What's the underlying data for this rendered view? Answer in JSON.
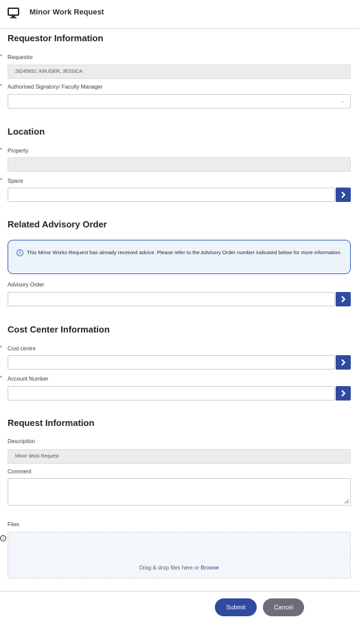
{
  "header": {
    "title": "Minor Work Request",
    "icon": "monitor-icon"
  },
  "sections": {
    "requestor": {
      "title": "Requestor Information",
      "requestor_label": "Requestor",
      "requestor_value": "28245652, KRUGER, JESSICA",
      "signatory_label": "Authorised Signatory/ Faculty Manager",
      "signatory_value": ""
    },
    "location": {
      "title": "Location",
      "property_label": "Property",
      "property_value": "",
      "space_label": "Space",
      "space_value": ""
    },
    "advisory": {
      "title": "Related Advisory Order",
      "info_text": "This Minor Works Request has already received advice. Please refer to the Advisory Order number indicated below for more information.",
      "order_label": "Advisory Order",
      "order_value": ""
    },
    "cost": {
      "title": "Cost Center Information",
      "cost_centre_label": "Cost centre",
      "cost_centre_value": "",
      "account_label": "Account Number",
      "account_value": ""
    },
    "request": {
      "title": "Request Information",
      "description_label": "Description",
      "description_value": "Minor Work Request",
      "comment_label": "Comment",
      "comment_value": "",
      "files_label": "Files",
      "drop_text": "Drag & drop files here or ",
      "browse_text": "Browse"
    }
  },
  "required_marker": "*",
  "buttons": {
    "submit": "Submit",
    "cancel": "Cancel"
  },
  "colors": {
    "primary": "#2f4aa0",
    "cancel": "#6b6f75",
    "required": "#c62828",
    "info_border": "#3a64b8"
  }
}
